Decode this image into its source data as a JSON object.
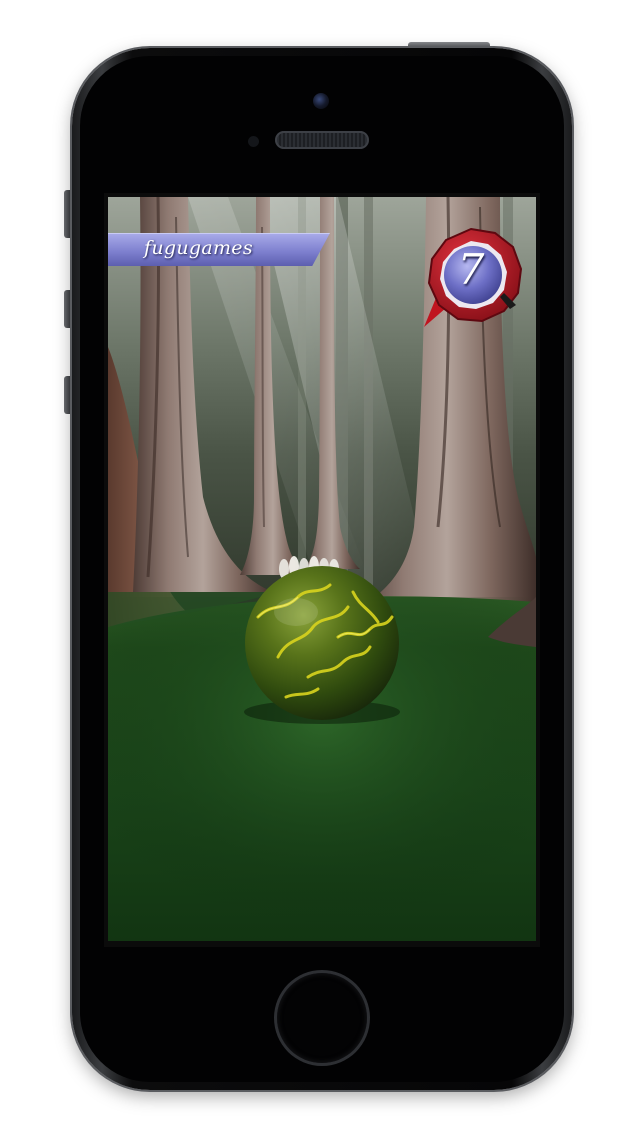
{
  "hud": {
    "player_name": "fugugames",
    "score": "7"
  },
  "colors": {
    "banner": "#7e80cf",
    "badge_ring": "#b3121f",
    "badge_core": "#6a6cc0",
    "ball": "#4a6a12",
    "ball_veins": "#d6d21c",
    "floor": "#18441a"
  },
  "icons": {
    "ball": "mossy-bowling-ball",
    "pins": "bowling-pins"
  }
}
